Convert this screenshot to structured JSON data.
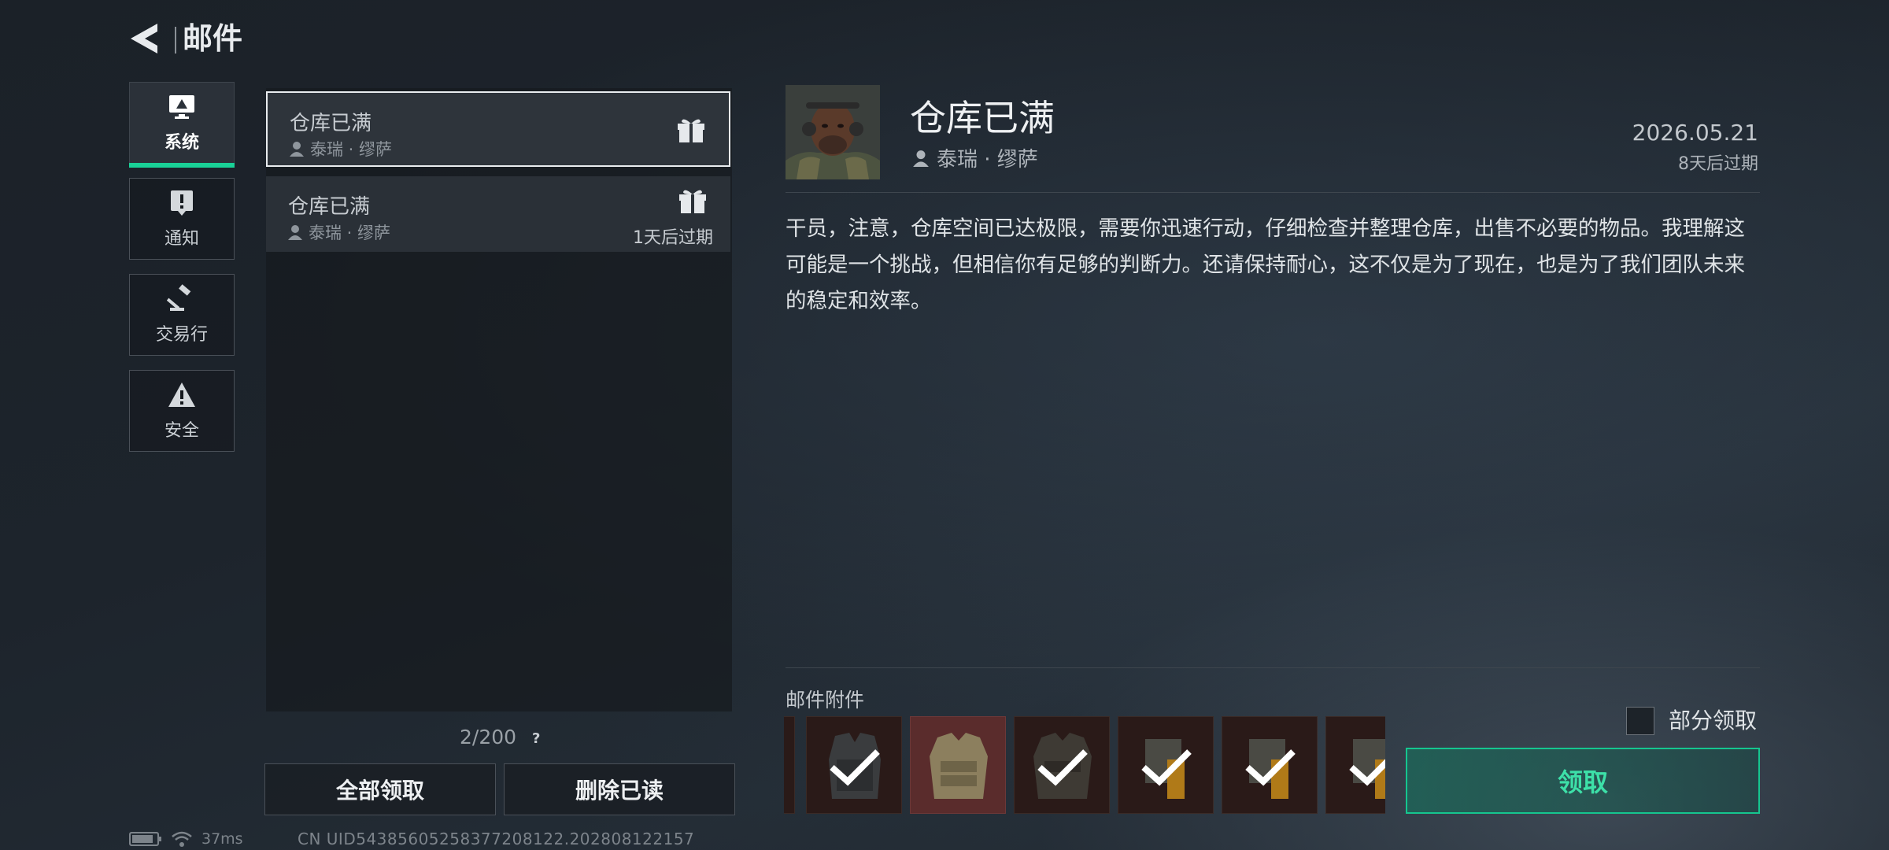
{
  "header": {
    "title": "邮件",
    "back_icon": "back-arrow-icon"
  },
  "categories": [
    {
      "label": "系统",
      "icon": "monitor-icon",
      "active": true
    },
    {
      "label": "通知",
      "icon": "exclamation-icon",
      "active": false
    },
    {
      "label": "交易行",
      "icon": "gavel-icon",
      "active": false
    },
    {
      "label": "安全",
      "icon": "warning-triangle-icon",
      "active": false
    }
  ],
  "mail_list": {
    "items": [
      {
        "title": "仓库已满",
        "sender": "泰瑞 · 缪萨",
        "has_gift": true,
        "expiry": "",
        "selected": true
      },
      {
        "title": "仓库已满",
        "sender": "泰瑞 · 缪萨",
        "has_gift": true,
        "expiry": "1天后过期",
        "selected": false
      }
    ],
    "count": "2/200",
    "help": "?",
    "claim_all_label": "全部领取",
    "delete_read_label": "删除已读"
  },
  "detail": {
    "title": "仓库已满",
    "sender": "泰瑞 · 缪萨",
    "date": "2026.05.21",
    "expiry": "8天后过期",
    "body": "干员，注意，仓库空间已达极限，需要你迅速行动，仔细检查并整理仓库，出售不必要的物品。我理解这可能是一个挑战，但相信你有足够的判断力。还请保持耐心，这不仅是为了现在，也是为了我们团队未来的稳定和效率。",
    "attachments_label": "邮件附件",
    "attachments": [
      {
        "icon": "vest-icon",
        "checked": true,
        "rarity": "dark"
      },
      {
        "icon": "armor-plate-icon",
        "checked": false,
        "rarity": "red"
      },
      {
        "icon": "armor-plate-icon",
        "checked": true,
        "rarity": "dark"
      },
      {
        "icon": "ammo-pack-icon",
        "checked": true,
        "rarity": "dark"
      },
      {
        "icon": "ammo-pack-icon",
        "checked": true,
        "rarity": "dark"
      },
      {
        "icon": "ammo-pack-icon",
        "checked": true,
        "rarity": "dark"
      }
    ],
    "partial_claim_label": "部分领取",
    "claim_label": "领取"
  },
  "status_bar": {
    "ping": "37ms",
    "uid": "CN UID543856052583772081​22.202808122157"
  },
  "colors": {
    "accent": "#19d197",
    "claim_border": "#15c68f",
    "panel": "#2a3037"
  }
}
